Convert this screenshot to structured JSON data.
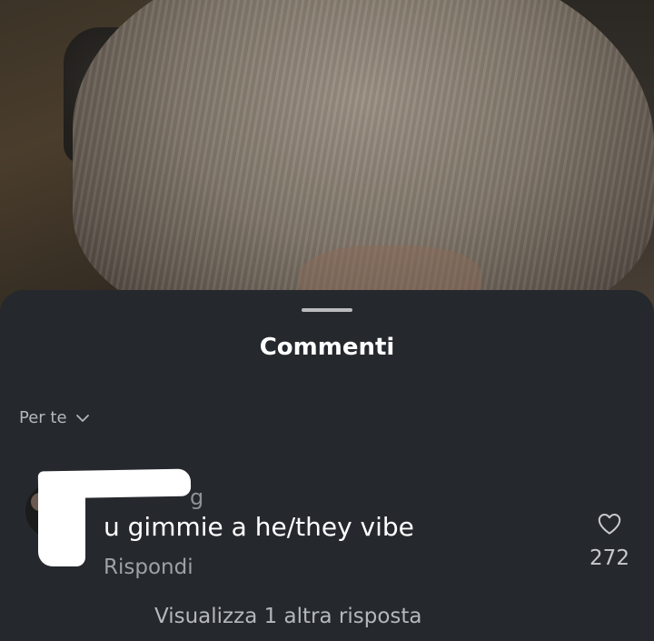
{
  "sheet": {
    "title": "Commenti",
    "sort_label": "Per te"
  },
  "comment": {
    "username_visible": "g",
    "text": "u gimmie a he/they vibe",
    "reply_label": "Rispondi",
    "like_count": "272"
  },
  "view_more_label": "Visualizza 1 altra risposta"
}
